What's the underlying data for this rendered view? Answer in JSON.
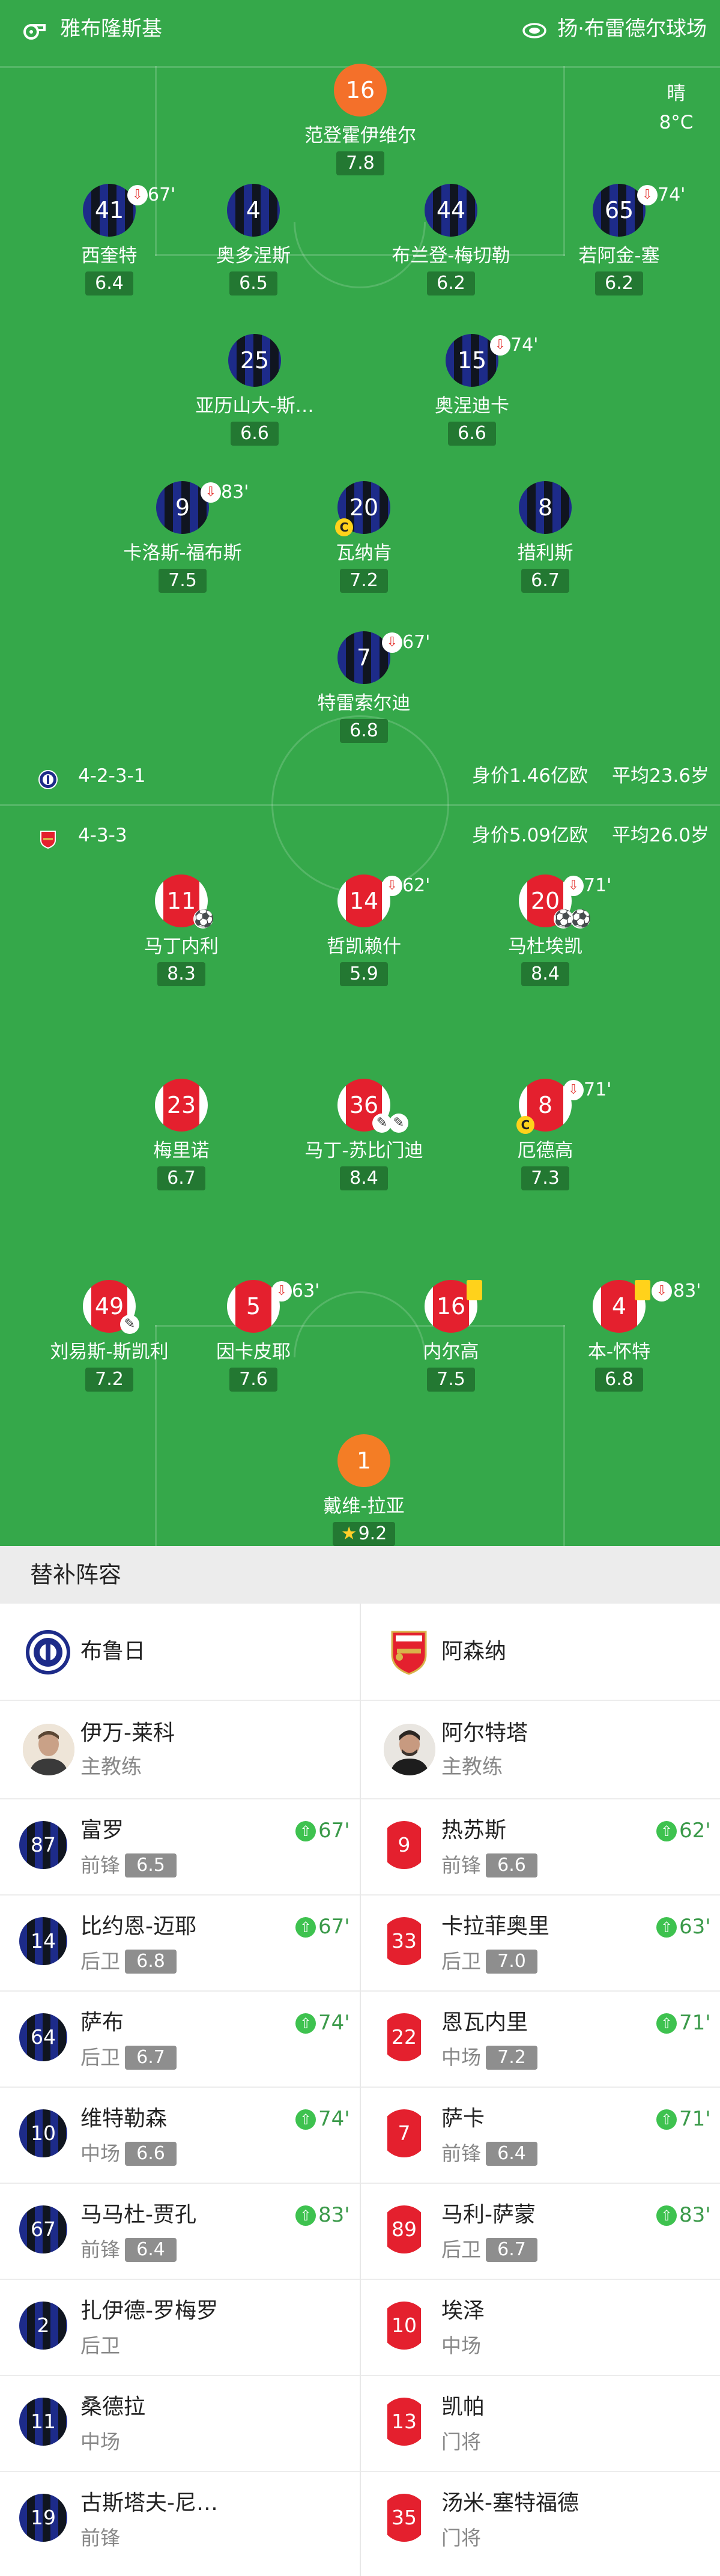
{
  "header": {
    "referee": "雅布隆斯基",
    "venue": "扬·布雷德尔球场"
  },
  "weather": {
    "condition": "晴",
    "temperature": "8°C"
  },
  "home": {
    "formation": "4-2-3-1",
    "value": "身价1.46亿欧",
    "age": "平均23.6岁",
    "players": [
      {
        "num": "16",
        "name": "范登霍伊维尔",
        "rating": "7.8"
      },
      {
        "num": "41",
        "name": "西奎特",
        "rating": "6.4",
        "sub": "67'"
      },
      {
        "num": "4",
        "name": "奥多涅斯",
        "rating": "6.5"
      },
      {
        "num": "44",
        "name": "布兰登-梅切勒",
        "rating": "6.2"
      },
      {
        "num": "65",
        "name": "若阿金-塞",
        "rating": "6.2",
        "sub": "74'"
      },
      {
        "num": "25",
        "name": "亚历山大-斯…",
        "rating": "6.6"
      },
      {
        "num": "15",
        "name": "奥涅迪卡",
        "rating": "6.6",
        "sub": "74'"
      },
      {
        "num": "9",
        "name": "卡洛斯-福布斯",
        "rating": "7.5",
        "sub": "83'"
      },
      {
        "num": "20",
        "name": "瓦纳肯",
        "rating": "7.2",
        "captain": "C"
      },
      {
        "num": "8",
        "name": "措利斯",
        "rating": "6.7"
      },
      {
        "num": "7",
        "name": "特雷索尔迪",
        "rating": "6.8",
        "sub": "67'"
      }
    ]
  },
  "away": {
    "formation": "4-3-3",
    "value": "身价5.09亿欧",
    "age": "平均26.0岁",
    "players": [
      {
        "num": "11",
        "name": "马丁内利",
        "rating": "8.3"
      },
      {
        "num": "14",
        "name": "哲凯赖什",
        "rating": "5.9",
        "sub": "62'"
      },
      {
        "num": "20",
        "name": "马杜埃凯",
        "rating": "8.4",
        "sub": "71'"
      },
      {
        "num": "23",
        "name": "梅里诺",
        "rating": "6.7"
      },
      {
        "num": "36",
        "name": "马丁-苏比门迪",
        "rating": "8.4"
      },
      {
        "num": "8",
        "name": "厄德高",
        "rating": "7.3",
        "sub": "71'",
        "captain": "C"
      },
      {
        "num": "49",
        "name": "刘易斯-斯凯利",
        "rating": "7.2"
      },
      {
        "num": "5",
        "name": "因卡皮耶",
        "rating": "7.6",
        "sub": "63'"
      },
      {
        "num": "16",
        "name": "内尔高",
        "rating": "7.5"
      },
      {
        "num": "4",
        "name": "本-怀特",
        "rating": "6.8",
        "sub": "83'"
      },
      {
        "num": "1",
        "name": "戴维-拉亚",
        "rating": "9.2"
      }
    ]
  },
  "subs_title": "替补阵容",
  "subs": {
    "home": {
      "team": "布鲁日",
      "coach": {
        "name": "伊万-莱科",
        "role": "主教练"
      },
      "players": [
        {
          "num": "87",
          "name": "富罗",
          "pos": "前锋",
          "rating": "6.5",
          "in": "67'"
        },
        {
          "num": "14",
          "name": "比约恩-迈耶",
          "pos": "后卫",
          "rating": "6.8",
          "in": "67'"
        },
        {
          "num": "64",
          "name": "萨布",
          "pos": "后卫",
          "rating": "6.7",
          "in": "74'"
        },
        {
          "num": "10",
          "name": "维特勒森",
          "pos": "中场",
          "rating": "6.6",
          "in": "74'"
        },
        {
          "num": "67",
          "name": "马马杜-贾孔",
          "pos": "前锋",
          "rating": "6.4",
          "in": "83'"
        },
        {
          "num": "2",
          "name": "扎伊德-罗梅罗",
          "pos": "后卫"
        },
        {
          "num": "11",
          "name": "桑德拉",
          "pos": "中场"
        },
        {
          "num": "19",
          "name": "古斯塔夫-尼…",
          "pos": "前锋"
        }
      ]
    },
    "away": {
      "team": "阿森纳",
      "coach": {
        "name": "阿尔特塔",
        "role": "主教练"
      },
      "players": [
        {
          "num": "9",
          "name": "热苏斯",
          "pos": "前锋",
          "rating": "6.6",
          "in": "62'"
        },
        {
          "num": "33",
          "name": "卡拉菲奥里",
          "pos": "后卫",
          "rating": "7.0",
          "in": "63'"
        },
        {
          "num": "22",
          "name": "恩瓦内里",
          "pos": "中场",
          "rating": "7.2",
          "in": "71'"
        },
        {
          "num": "7",
          "name": "萨卡",
          "pos": "前锋",
          "rating": "6.4",
          "in": "71'"
        },
        {
          "num": "89",
          "name": "马利-萨蒙",
          "pos": "后卫",
          "rating": "6.7",
          "in": "83'"
        },
        {
          "num": "10",
          "name": "埃泽",
          "pos": "中场"
        },
        {
          "num": "13",
          "name": "凯帕",
          "pos": "门将"
        },
        {
          "num": "35",
          "name": "汤米-塞特福德",
          "pos": "门将"
        }
      ]
    }
  },
  "colors": {
    "pitch": "#35a84a",
    "inter_blue": "#1d2b89",
    "arsenal_red": "#e4202e",
    "gk_orange": "#f4702a",
    "sub_in_green": "#3ec24f"
  }
}
